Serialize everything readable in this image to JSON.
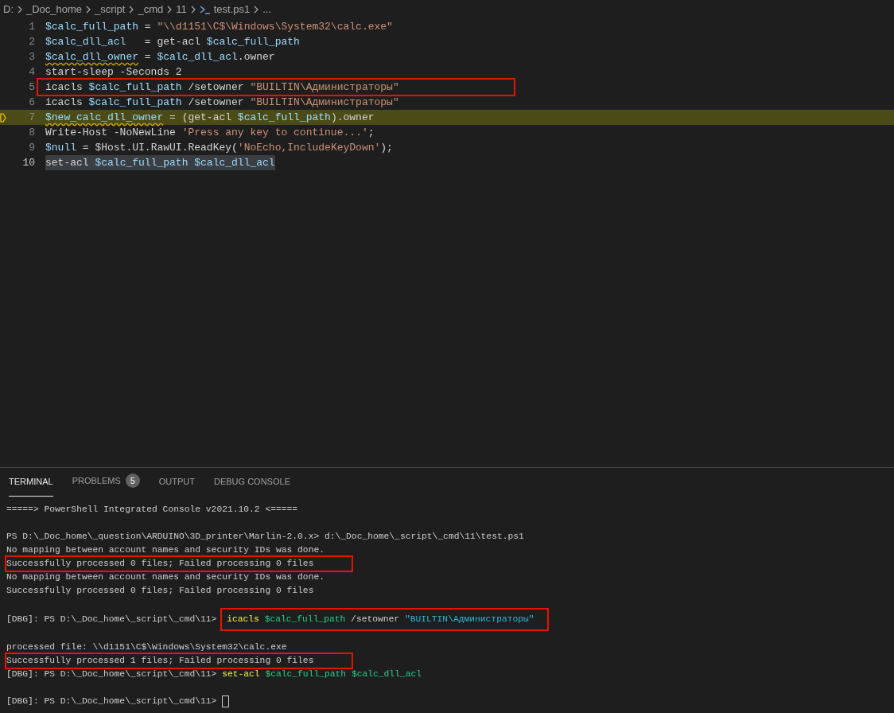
{
  "breadcrumb": [
    {
      "label": "D:",
      "kind": "folder"
    },
    {
      "label": "_Doc_home",
      "kind": "folder"
    },
    {
      "label": "_script",
      "kind": "folder"
    },
    {
      "label": "_cmd",
      "kind": "folder"
    },
    {
      "label": "11",
      "kind": "folder"
    },
    {
      "label": "test.ps1",
      "kind": "file"
    },
    {
      "label": "...",
      "kind": "more"
    }
  ],
  "editor": {
    "lines": [
      {
        "number": "1",
        "current": false,
        "paused": false,
        "selected": false,
        "parts": [
          {
            "boxed": false,
            "tokens": [
              {
                "text": "$calc_full_path",
                "kind": "variable"
              },
              {
                "text": " = ",
                "kind": "plain"
              },
              {
                "text": "\"\\\\d1151\\C$\\Windows\\System32\\calc.exe\"",
                "kind": "string"
              }
            ]
          }
        ]
      },
      {
        "number": "2",
        "current": false,
        "paused": false,
        "selected": false,
        "parts": [
          {
            "boxed": false,
            "tokens": [
              {
                "text": "$calc_dll_acl",
                "kind": "variable"
              },
              {
                "text": "   = get-acl ",
                "kind": "plain"
              },
              {
                "text": "$calc_full_path",
                "kind": "variable"
              }
            ]
          }
        ]
      },
      {
        "number": "3",
        "current": false,
        "paused": false,
        "selected": false,
        "parts": [
          {
            "boxed": false,
            "tokens": [
              {
                "text": "$calc_dll_owner",
                "kind": "variable_warning"
              },
              {
                "text": " = ",
                "kind": "plain"
              },
              {
                "text": "$calc_dll_acl",
                "kind": "variable"
              },
              {
                "text": ".owner",
                "kind": "plain"
              }
            ]
          }
        ]
      },
      {
        "number": "4",
        "current": false,
        "paused": false,
        "selected": false,
        "parts": [
          {
            "boxed": false,
            "tokens": [
              {
                "text": "start-sleep -Seconds 2",
                "kind": "plain"
              }
            ]
          }
        ]
      },
      {
        "number": "5",
        "current": false,
        "paused": false,
        "selected": false,
        "parts": [
          {
            "boxed": true,
            "tokens": [
              {
                "text": "icacls ",
                "kind": "plain"
              },
              {
                "text": "$calc_full_path",
                "kind": "variable"
              },
              {
                "text": " /setowner ",
                "kind": "plain"
              },
              {
                "text": "\"BUILTIN\\Администраторы\"",
                "kind": "string"
              }
            ]
          }
        ]
      },
      {
        "number": "6",
        "current": false,
        "paused": false,
        "selected": false,
        "parts": [
          {
            "boxed": false,
            "tokens": [
              {
                "text": "icacls ",
                "kind": "plain"
              },
              {
                "text": "$calc_full_path",
                "kind": "variable"
              },
              {
                "text": " /setowner ",
                "kind": "plain"
              },
              {
                "text": "\"BUILTIN\\Администраторы\"",
                "kind": "string"
              }
            ]
          }
        ]
      },
      {
        "number": "7",
        "current": false,
        "paused": true,
        "selected": false,
        "parts": [
          {
            "boxed": false,
            "tokens": [
              {
                "text": "$new_calc_dll_owner",
                "kind": "variable_warning"
              },
              {
                "text": " = (get-acl ",
                "kind": "plain"
              },
              {
                "text": "$calc_full_path",
                "kind": "variable"
              },
              {
                "text": ").owner",
                "kind": "plain"
              }
            ]
          }
        ]
      },
      {
        "number": "8",
        "current": false,
        "paused": false,
        "selected": false,
        "parts": [
          {
            "boxed": false,
            "tokens": [
              {
                "text": "Write-Host -NoNewLine ",
                "kind": "plain"
              },
              {
                "text": "'Press any key to continue...'",
                "kind": "string"
              },
              {
                "text": ";",
                "kind": "plain"
              }
            ]
          }
        ]
      },
      {
        "number": "9",
        "current": false,
        "paused": false,
        "selected": false,
        "parts": [
          {
            "boxed": false,
            "tokens": [
              {
                "text": "$null",
                "kind": "variable"
              },
              {
                "text": " = $Host.UI.RawUI.ReadKey(",
                "kind": "plain"
              },
              {
                "text": "'NoEcho,IncludeKeyDown'",
                "kind": "string"
              },
              {
                "text": ");",
                "kind": "plain"
              }
            ]
          }
        ]
      },
      {
        "number": "10",
        "current": true,
        "paused": false,
        "selected": true,
        "parts": [
          {
            "boxed": false,
            "tokens": [
              {
                "text": "set-acl ",
                "kind": "plain"
              },
              {
                "text": "$calc_full_path $calc_dll_acl",
                "kind": "variable"
              }
            ]
          }
        ]
      }
    ]
  },
  "panel": {
    "tabs": [
      {
        "label": "TERMINAL",
        "selected": true
      },
      {
        "label": "PROBLEMS",
        "selected": false,
        "badge": "5"
      },
      {
        "label": "OUTPUT",
        "selected": false
      },
      {
        "label": "DEBUG CONSOLE",
        "selected": false
      }
    ],
    "terminal": [
      {
        "kind": "output",
        "parts": [
          {
            "boxed": false,
            "tokens": [
              {
                "text": "=====> PowerShell Integrated Console v2021.10.2 <=====",
                "kind": "plain"
              }
            ]
          }
        ]
      },
      {
        "kind": "blank"
      },
      {
        "kind": "output",
        "parts": [
          {
            "boxed": false,
            "tokens": [
              {
                "text": "PS D:\\_Doc_home\\_question\\ARDUINO\\3D_printer\\Marlin-2.0.x> d:\\_Doc_home\\_script\\_cmd\\11\\test.ps1",
                "kind": "plain"
              }
            ]
          }
        ]
      },
      {
        "kind": "output",
        "parts": [
          {
            "boxed": false,
            "tokens": [
              {
                "text": "No mapping between account names and security IDs was done.",
                "kind": "plain"
              }
            ]
          }
        ]
      },
      {
        "kind": "output",
        "parts": [
          {
            "boxed": true,
            "tokens": [
              {
                "text": "Successfully processed 0 files; Failed processing 0 files",
                "kind": "plain"
              }
            ]
          }
        ]
      },
      {
        "kind": "output",
        "parts": [
          {
            "boxed": false,
            "tokens": [
              {
                "text": "No mapping between account names and security IDs was done.",
                "kind": "plain"
              }
            ]
          }
        ]
      },
      {
        "kind": "output",
        "parts": [
          {
            "boxed": false,
            "tokens": [
              {
                "text": "Successfully processed 0 files; Failed processing 0 files",
                "kind": "plain"
              }
            ]
          }
        ]
      },
      {
        "kind": "blank"
      },
      {
        "kind": "output",
        "parts": [
          {
            "boxed": false,
            "tokens": [
              {
                "text": "[DBG]: PS D:\\_Doc_home\\_script\\_cmd\\11> ",
                "kind": "plain"
              }
            ]
          },
          {
            "boxed": true,
            "tokens": [
              {
                "text": "icacls",
                "kind": "command"
              },
              {
                "text": " $calc_full_path",
                "kind": "variable"
              },
              {
                "text": " /setowner ",
                "kind": "plain"
              },
              {
                "text": "\"BUILTIN\\Администраторы\"",
                "kind": "string"
              }
            ]
          }
        ]
      },
      {
        "kind": "blank"
      },
      {
        "kind": "output",
        "parts": [
          {
            "boxed": false,
            "tokens": [
              {
                "text": "processed file: \\\\d1151\\C$\\Windows\\System32\\calc.exe",
                "kind": "plain"
              }
            ]
          }
        ]
      },
      {
        "kind": "output",
        "parts": [
          {
            "boxed": true,
            "tokens": [
              {
                "text": "Successfully processed 1 files; Failed processing 0 files",
                "kind": "plain"
              }
            ]
          }
        ]
      },
      {
        "kind": "output",
        "parts": [
          {
            "boxed": false,
            "tokens": [
              {
                "text": "[DBG]: PS D:\\_Doc_home\\_script\\_cmd\\11> ",
                "kind": "plain"
              },
              {
                "text": "set-acl",
                "kind": "command"
              },
              {
                "text": " $calc_full_path $calc_dll_acl",
                "kind": "variable"
              }
            ]
          }
        ]
      },
      {
        "kind": "blank"
      },
      {
        "kind": "prompt",
        "parts": [
          {
            "boxed": false,
            "tokens": [
              {
                "text": "[DBG]: PS D:\\_Doc_home\\_script\\_cmd\\11> ",
                "kind": "plain"
              }
            ]
          }
        ]
      }
    ]
  }
}
